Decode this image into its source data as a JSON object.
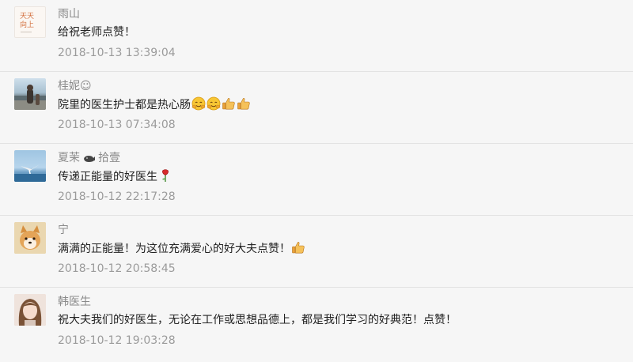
{
  "comments": [
    {
      "name": "雨山",
      "text": "给祝老师点赞！",
      "time": "2018-10-13 13:39:04",
      "avatar_text": [
        "天天",
        "向上"
      ]
    },
    {
      "name": "桂妮☺",
      "text": "院里的医生护士都是热心肠",
      "time": "2018-10-13 07:34:08"
    },
    {
      "name": "夏茉",
      "name_suffix": "拾壹",
      "text": "传递正能量的好医生",
      "time": "2018-10-12 22:17:28"
    },
    {
      "name": "宁",
      "text": "满满的正能量！为这位充满爱心的好大夫点赞！",
      "time": "2018-10-12 20:58:45"
    },
    {
      "name": "韩医生",
      "text": "祝大夫我们的好医生，无论在工作或思想品德上，都是我们学习的好典范！点赞！",
      "time": "2018-10-12 19:03:28"
    }
  ],
  "colors": {
    "background": "#f6f6f6",
    "name": "#8a8a8a",
    "text": "#222222",
    "time": "#9b9b9b",
    "divider": "#e3e3e3"
  }
}
